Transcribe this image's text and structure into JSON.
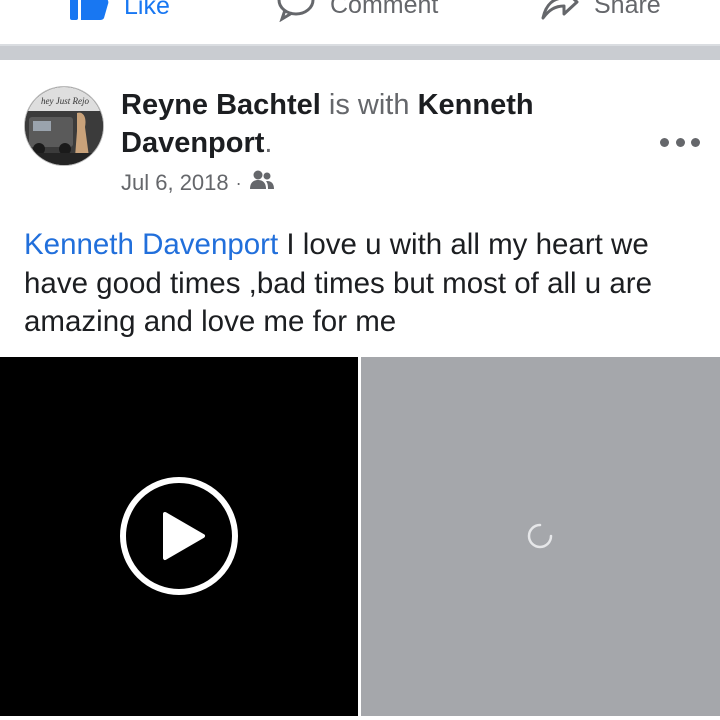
{
  "actions": {
    "like_label": "Like",
    "comment_label": "Comment",
    "share_label": "Share"
  },
  "post": {
    "author": "Reyne Bachtel",
    "with_text": "is with",
    "tagged": "Kenneth Davenport",
    "tagged_suffix": ".",
    "date": "Jul 6, 2018",
    "separator": "·",
    "audience_icon": "friends-icon",
    "message_mention": "Kenneth Davenport",
    "message_text": " I love u with all my heart we have good times ,bad times but most of all u are amazing and love me for me"
  },
  "avatar": {
    "banner_text": "hey Just Rejo"
  },
  "colors": {
    "link": "#216fdb",
    "like_blue": "#1877f2",
    "secondary_text": "#65676b",
    "separator": "#c9ccd1",
    "media_placeholder": "#a5a7ab"
  }
}
